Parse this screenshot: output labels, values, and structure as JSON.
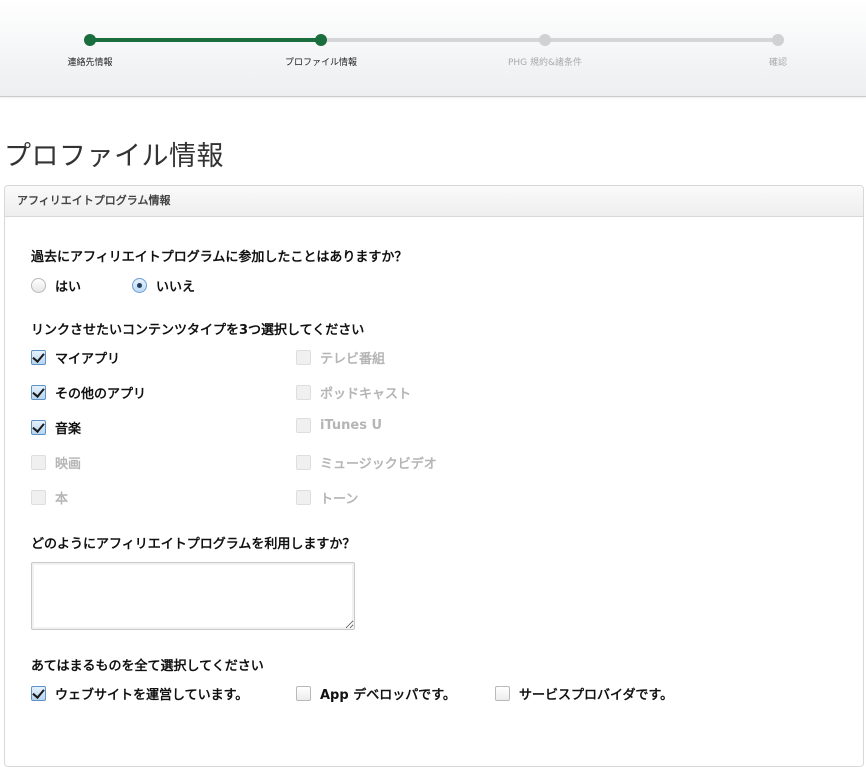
{
  "progress": {
    "steps": [
      {
        "label": "連絡先情報",
        "state": "done"
      },
      {
        "label": "プロファイル情報",
        "state": "done"
      },
      {
        "label": "PHG 規約&諸条件",
        "state": "todo"
      },
      {
        "label": "確認",
        "state": "todo"
      }
    ],
    "active_color": "#1a6d3c",
    "inactive_color": "#d4d6d8"
  },
  "page_title": "プロファイル情報",
  "panel": {
    "header": "アフィリエイトプログラム情報",
    "q1": {
      "question": "過去にアフィリエイトプログラムに参加したことはありますか？",
      "options": [
        {
          "label": "はい",
          "selected": false
        },
        {
          "label": "いいえ",
          "selected": true
        }
      ]
    },
    "q2": {
      "question": "リンクさせたいコンテンツタイプを3つ選択してください",
      "options": [
        {
          "label": "マイアプリ",
          "checked": true,
          "disabled": false
        },
        {
          "label": "その他のアプリ",
          "checked": true,
          "disabled": false
        },
        {
          "label": "音楽",
          "checked": true,
          "disabled": false
        },
        {
          "label": "映画",
          "checked": false,
          "disabled": true
        },
        {
          "label": "本",
          "checked": false,
          "disabled": true
        },
        {
          "label": "テレビ番組",
          "checked": false,
          "disabled": true
        },
        {
          "label": "ポッドキャスト",
          "checked": false,
          "disabled": true
        },
        {
          "label": "iTunes U",
          "checked": false,
          "disabled": true
        },
        {
          "label": "ミュージックビデオ",
          "checked": false,
          "disabled": true
        },
        {
          "label": "トーン",
          "checked": false,
          "disabled": true
        }
      ]
    },
    "q3": {
      "question": "どのようにアフィリエイトプログラムを利用しますか？",
      "value": ""
    },
    "q4": {
      "question": "あてはまるものを全て選択してください",
      "options": [
        {
          "label": "ウェブサイトを運営しています。",
          "checked": true
        },
        {
          "label": "App デベロッパです。",
          "checked": false
        },
        {
          "label": "サービスプロバイダです。",
          "checked": false
        }
      ]
    }
  }
}
